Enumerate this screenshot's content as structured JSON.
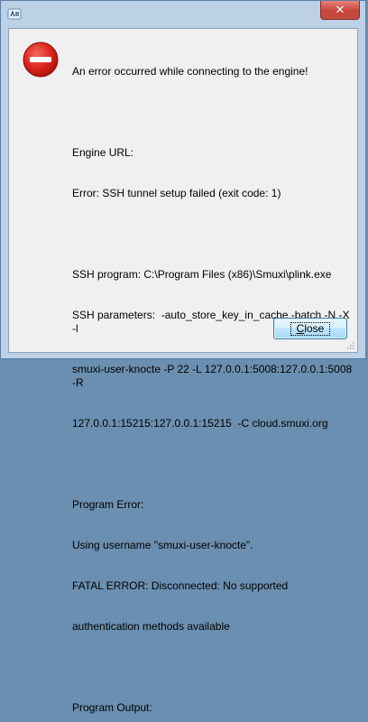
{
  "window": {
    "close_glyph": "✕",
    "app_icon": "smuxi-icon",
    "accent_error": "#d9231c"
  },
  "dialog": {
    "icon": "error-icon",
    "line_header": "An error occurred while connecting to the engine!",
    "engine_url_label": "Engine URL:",
    "engine_error": "Error: SSH tunnel setup failed (exit code: 1)",
    "ssh_program": "SSH program: C:\\Program Files (x86)\\Smuxi\\plink.exe",
    "ssh_params_1": "SSH parameters:  -auto_store_key_in_cache -batch -N -X -l",
    "ssh_params_2": "smuxi-user-knocte -P 22 -L 127.0.0.1:5008:127.0.0.1:5008 -R",
    "ssh_params_3": "127.0.0.1:15215:127.0.0.1:15215  -C cloud.smuxi.org",
    "program_error_label": "Program Error:",
    "using_username": "Using username \"smuxi-user-knocte\".",
    "fatal_1": "FATAL ERROR: Disconnected: No supported",
    "fatal_2": "authentication methods available",
    "program_output_label": "Program Output:"
  },
  "buttons": {
    "close_mnemonic": "C",
    "close_rest": "lose"
  }
}
